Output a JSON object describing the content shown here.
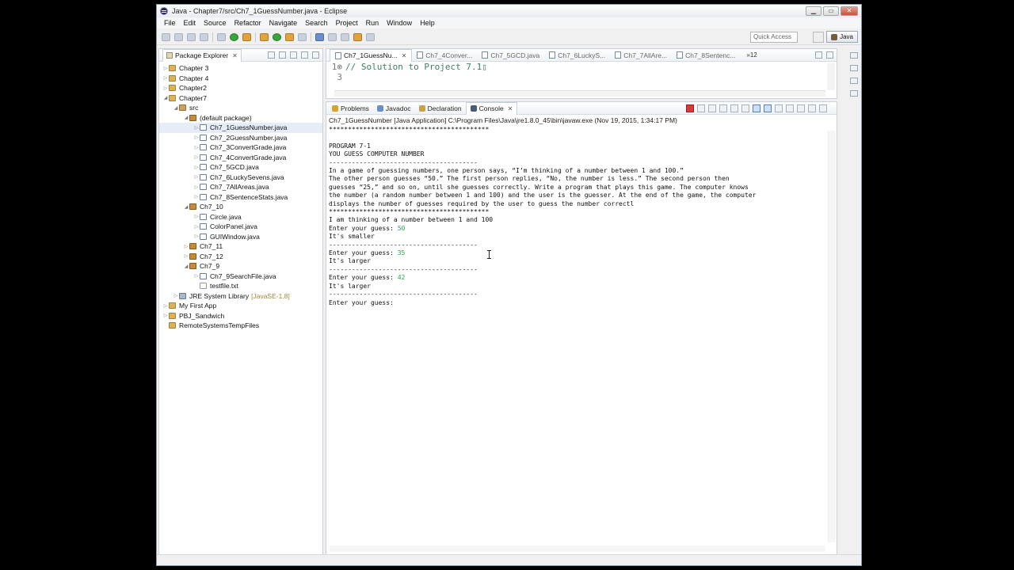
{
  "window": {
    "title": "Java - Chapter7/src/Ch7_1GuessNumber.java - Eclipse"
  },
  "menu": [
    "File",
    "Edit",
    "Source",
    "Refactor",
    "Navigate",
    "Search",
    "Project",
    "Run",
    "Window",
    "Help"
  ],
  "toolbar": {
    "quick_access": "Quick Access",
    "perspective": "Java"
  },
  "package_explorer": {
    "tab_label": "Package Explorer",
    "nodes": [
      {
        "label": "Chapter 3",
        "kind": "proj",
        "depth": 0,
        "tw": "▷"
      },
      {
        "label": "Chapter 4",
        "kind": "proj",
        "depth": 0,
        "tw": "▷"
      },
      {
        "label": "Chapter2",
        "kind": "proj",
        "depth": 0,
        "tw": "▷"
      },
      {
        "label": "Chapter7",
        "kind": "proj",
        "depth": 0,
        "tw": "◢"
      },
      {
        "label": "src",
        "kind": "src",
        "depth": 1,
        "tw": "◢"
      },
      {
        "label": "(default package)",
        "kind": "pkg",
        "depth": 2,
        "tw": "◢"
      },
      {
        "label": "Ch7_1GuessNumber.java",
        "kind": "file",
        "depth": 3,
        "tw": "▷",
        "selected": true
      },
      {
        "label": "Ch7_2GuessNumber.java",
        "kind": "file",
        "depth": 3,
        "tw": "▷"
      },
      {
        "label": "Ch7_3ConvertGrade.java",
        "kind": "file",
        "depth": 3,
        "tw": "▷"
      },
      {
        "label": "Ch7_4ConvertGrade.java",
        "kind": "file",
        "depth": 3,
        "tw": "▷"
      },
      {
        "label": "Ch7_5GCD.java",
        "kind": "file",
        "depth": 3,
        "tw": "▷"
      },
      {
        "label": "Ch7_6LuckySevens.java",
        "kind": "file",
        "depth": 3,
        "tw": "▷"
      },
      {
        "label": "Ch7_7AllAreas.java",
        "kind": "file",
        "depth": 3,
        "tw": "▷"
      },
      {
        "label": "Ch7_8SentenceStats.java",
        "kind": "file",
        "depth": 3,
        "tw": "▷"
      },
      {
        "label": "Ch7_10",
        "kind": "pkg",
        "depth": 2,
        "tw": "◢"
      },
      {
        "label": "Circle.java",
        "kind": "file",
        "depth": 3,
        "tw": "▷"
      },
      {
        "label": "ColorPanel.java",
        "kind": "file",
        "depth": 3,
        "tw": "▷"
      },
      {
        "label": "GUIWindow.java",
        "kind": "file",
        "depth": 3,
        "tw": "▷"
      },
      {
        "label": "Ch7_11",
        "kind": "pkg",
        "depth": 2,
        "tw": "▷"
      },
      {
        "label": "Ch7_12",
        "kind": "pkg",
        "depth": 2,
        "tw": "▷"
      },
      {
        "label": "Ch7_9",
        "kind": "pkg",
        "depth": 2,
        "tw": "◢"
      },
      {
        "label": "Ch7_9SearchFile.java",
        "kind": "file",
        "depth": 3,
        "tw": "▷"
      },
      {
        "label": "testfile.txt",
        "kind": "txt",
        "depth": 3,
        "tw": ""
      },
      {
        "label": "JRE System Library",
        "kind": "lib",
        "depth": 1,
        "tw": "▷",
        "extra": "[JavaSE-1.8]"
      },
      {
        "label": "My First App",
        "kind": "proj",
        "depth": 0,
        "tw": "▷"
      },
      {
        "label": "PBJ_Sandwich",
        "kind": "proj",
        "depth": 0,
        "tw": "▷"
      },
      {
        "label": "RemoteSystemsTempFiles",
        "kind": "proj",
        "depth": 0,
        "tw": ""
      }
    ]
  },
  "editor": {
    "tabs": [
      "Ch7_1GuessNu...",
      "Ch7_4Conver...",
      "Ch7_5GCD.java",
      "Ch7_6LuckyS...",
      "Ch7_7AllAre...",
      "Ch7_8Sentenc..."
    ],
    "overflow": "»12",
    "lines": [
      {
        "no": "1⊕",
        "text": "// Solution to Project 7.1▯"
      },
      {
        "no": "3",
        "text": ""
      }
    ]
  },
  "console": {
    "tabs": [
      "Problems",
      "Javadoc",
      "Declaration",
      "Console"
    ],
    "description": "Ch7_1GuessNumber [Java Application] C:\\Program Files\\Java\\jre1.8.0_45\\bin\\javaw.exe (Nov 19, 2015, 1:34:17 PM)",
    "output": [
      {
        "t": "******************************************"
      },
      {
        "t": ""
      },
      {
        "t": "PROGRAM 7-1"
      },
      {
        "t": "YOU GUESS COMPUTER NUMBER"
      },
      {
        "t": "---------------------------------------"
      },
      {
        "t": "In a game of guessing numbers, one person says, “I’m thinking of a number between 1 and 100.”"
      },
      {
        "t": "The other person guesses “50.” The first person replies, “No, the number is less.” The second person then"
      },
      {
        "t": "guesses “25,” and so on, until she guesses correctly. Write a program that plays this game. The computer knows"
      },
      {
        "t": "the number (a random number between 1 and 100) and the user is the guesser. At the end of the game, the computer"
      },
      {
        "t": "displays the number of guesses required by the user to guess the number correctl"
      },
      {
        "t": "******************************************"
      },
      {
        "t": "I am thinking of a number between 1 and 100"
      },
      {
        "t": "Enter your guess: ",
        "input": "50"
      },
      {
        "t": "It's smaller"
      },
      {
        "t": "---------------------------------------"
      },
      {
        "t": "Enter your guess: ",
        "input": "35"
      },
      {
        "t": "It's larger"
      },
      {
        "t": "---------------------------------------"
      },
      {
        "t": "Enter your guess: ",
        "input": "42"
      },
      {
        "t": "It's larger"
      },
      {
        "t": "---------------------------------------"
      },
      {
        "t": "Enter your guess: "
      }
    ]
  }
}
